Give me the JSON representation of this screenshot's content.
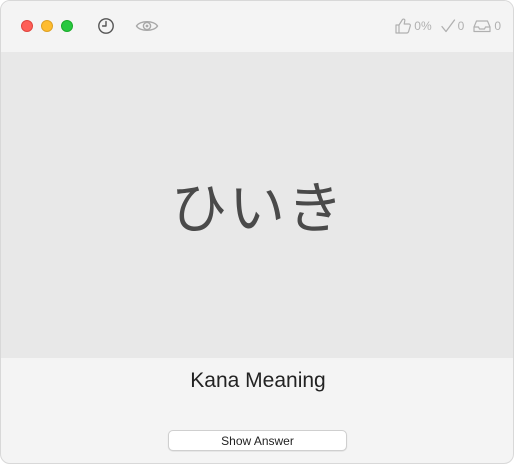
{
  "toolbar": {
    "history_icon": "clock-icon",
    "preview_icon": "eye-icon"
  },
  "stats": {
    "likes_icon": "thumbs-up-icon",
    "likes_value": "0%",
    "correct_icon": "checkmark-icon",
    "correct_value": "0",
    "inbox_icon": "inbox-tray-icon",
    "inbox_value": "0"
  },
  "card": {
    "prompt": "ひいき"
  },
  "answer": {
    "label": "Kana Meaning",
    "button_label": "Show Answer"
  },
  "colors": {
    "card_background": "#e8e8e8",
    "window_background": "#f4f4f4",
    "kana_text": "#4a4a4a",
    "stat_gray": "#b0b0b0",
    "close": "#fe5f57",
    "minimize": "#febc2e",
    "zoom": "#28c840"
  }
}
